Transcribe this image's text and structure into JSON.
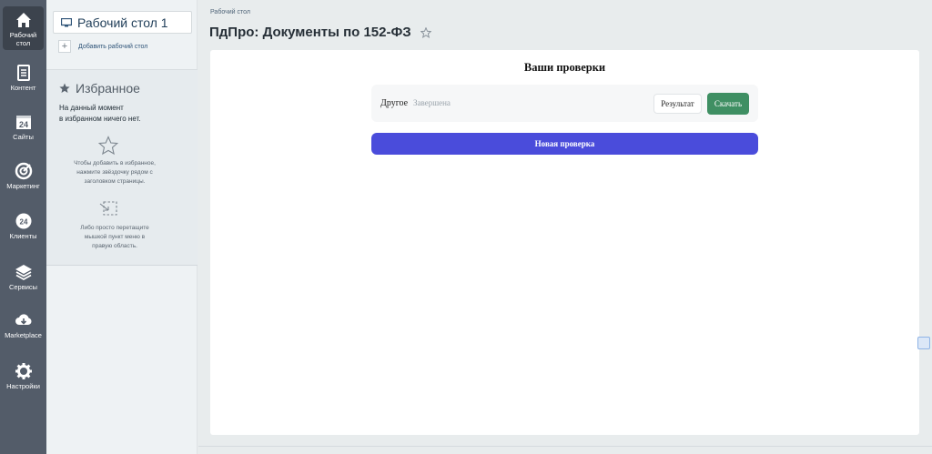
{
  "rail": {
    "items": [
      {
        "label": "Рабочий стол",
        "icon": "home-icon"
      },
      {
        "label": "Контент",
        "icon": "document-icon"
      },
      {
        "label": "Сайты",
        "icon": "calendar-24-icon"
      },
      {
        "label": "Маркетинг",
        "icon": "target-icon"
      },
      {
        "label": "Клиенты",
        "icon": "clients-24-icon"
      },
      {
        "label": "Сервисы",
        "icon": "layers-icon"
      },
      {
        "label": "Marketplace",
        "icon": "cloud-download-icon"
      },
      {
        "label": "Настройки",
        "icon": "gear-icon"
      }
    ],
    "cal_number": "24",
    "clients_number": "24"
  },
  "panel": {
    "desktop_button": "Рабочий стол 1",
    "add_desktop": "Добавить рабочий стол",
    "add_symbol": "+",
    "favorites": {
      "title": "Избранное",
      "empty_line1": "На данный момент",
      "empty_line2": "в избранном ничего нет.",
      "hint1_line1": "Чтобы добавить в избранное,",
      "hint1_line2": "нажмите звёздочку рядом с",
      "hint1_line3": "заголовком страницы.",
      "hint2_line1": "Либо просто перетащите",
      "hint2_line2": "мышкой пункт меню в",
      "hint2_line3": "правую область."
    }
  },
  "main": {
    "breadcrumb": "Рабочий стол",
    "title": "ПдПро: Документы по 152-ФЗ",
    "section_title": "Ваши проверки",
    "check": {
      "type": "Другое",
      "status": "Завершена",
      "result_button": "Результат",
      "download_button": "Скачать"
    },
    "new_check_button": "Новая проверка"
  },
  "colors": {
    "rail_bg": "#535c69",
    "download_green": "#3f8f63",
    "new_check_blue": "#4a4cdb"
  }
}
